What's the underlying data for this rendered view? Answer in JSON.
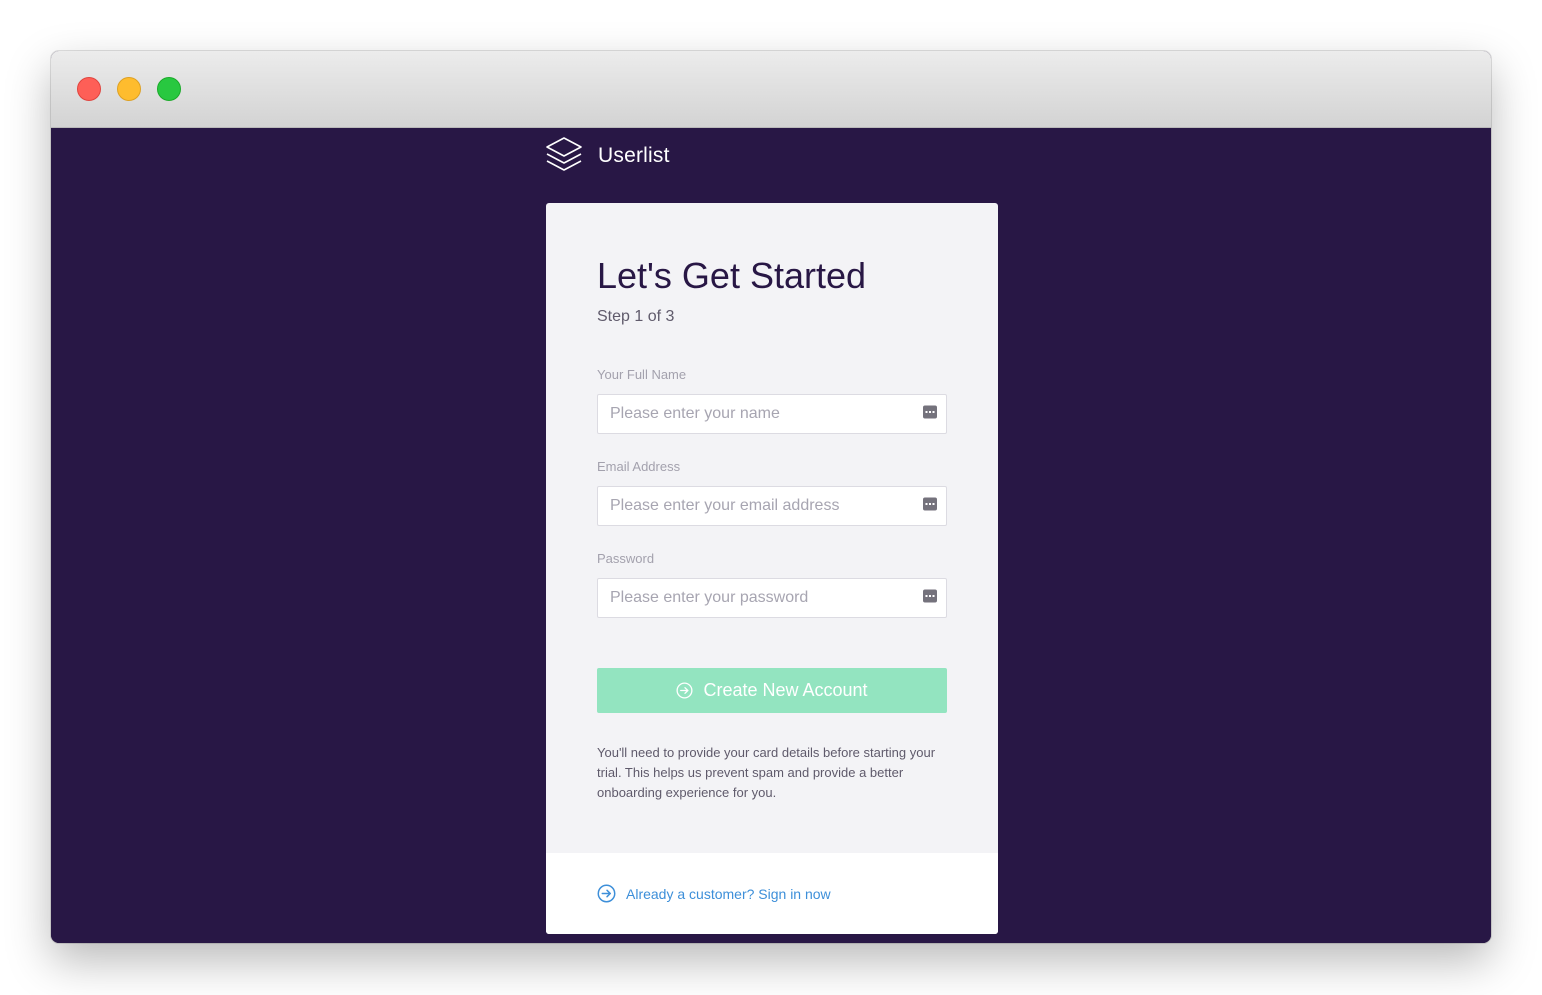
{
  "window": {
    "controls": [
      "close",
      "minimize",
      "maximize"
    ]
  },
  "brand": {
    "name": "Userlist",
    "icon": "stacked-layers-logo-icon"
  },
  "form": {
    "title": "Let's Get Started",
    "step": "Step 1 of 3",
    "fields": [
      {
        "label": "Your Full Name",
        "placeholder": "Please enter your name",
        "value": "",
        "icon": "keyboard-icon"
      },
      {
        "label": "Email Address",
        "placeholder": "Please enter your email address",
        "value": "",
        "icon": "keyboard-icon"
      },
      {
        "label": "Password",
        "placeholder": "Please enter your password",
        "value": "",
        "icon": "keyboard-icon"
      }
    ],
    "submit_label": "Create New Account",
    "submit_icon": "arrow-circle-right-icon",
    "note": "You'll need to provide your card details before starting your trial. This helps us prevent spam and provide a better onboarding experience for you."
  },
  "footer": {
    "signin_label": "Already a customer? Sign in now",
    "signin_icon": "arrow-circle-right-icon"
  },
  "colors": {
    "background": "#281745",
    "card": "#f3f3f6",
    "button": "#93e4c0",
    "link": "#3d8fd9",
    "heading": "#281745"
  }
}
